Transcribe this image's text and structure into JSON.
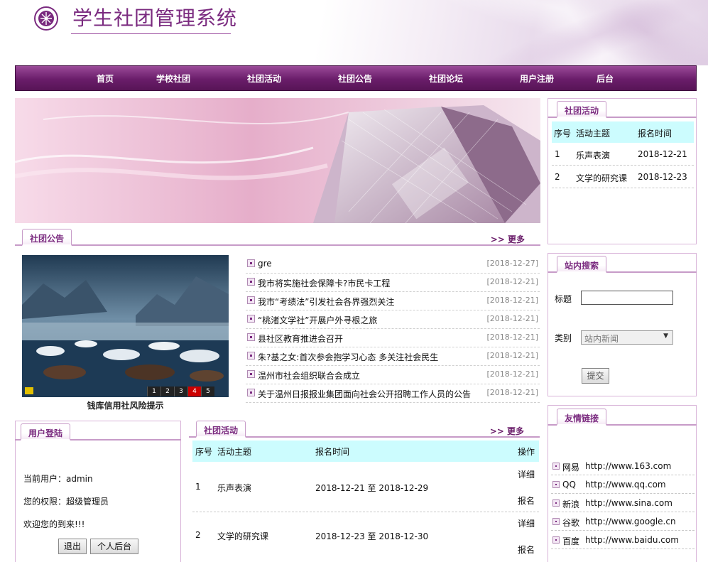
{
  "header": {
    "title": "学生社团管理系统"
  },
  "nav": {
    "items": [
      "首页",
      "学校社团",
      "社团活动",
      "社团公告",
      "社团论坛",
      "用户注册",
      "后台"
    ]
  },
  "notice_panel": {
    "tab_label": "社团公告",
    "more_label": ">> 更多",
    "photo_caption": "钱库信用社风险提示",
    "pager": [
      "1",
      "2",
      "3",
      "4",
      "5"
    ],
    "pager_active": "4",
    "items": [
      {
        "title": "gre",
        "date": "[2018-12-27]"
      },
      {
        "title": "我市将实施社会保障卡?市民卡工程",
        "date": "[2018-12-21]"
      },
      {
        "title": "我市“考绩法”引发社会各界强烈关注",
        "date": "[2018-12-21]"
      },
      {
        "title": "“桃渚文学社”开展户外寻根之旅",
        "date": "[2018-12-21]"
      },
      {
        "title": "县社区教育推进会召开",
        "date": "[2018-12-21]"
      },
      {
        "title": "朱?基之女:首次参会抱学习心态 多关注社会民生",
        "date": "[2018-12-21]"
      },
      {
        "title": "温州市社会组织联合会成立",
        "date": "[2018-12-21]"
      },
      {
        "title": "关于温州日报报业集团面向社会公开招聘工作人员的公告",
        "date": "[2018-12-21]"
      }
    ]
  },
  "sidebar_activity": {
    "tab_label": "社团活动",
    "headers": [
      "序号",
      "活动主题",
      "报名时间"
    ],
    "rows": [
      [
        "1",
        "乐声表演",
        "2018-12-21"
      ],
      [
        "2",
        "文学的研究课",
        "2018-12-23"
      ]
    ]
  },
  "search": {
    "tab_label": "站内搜索",
    "title_label": "标题",
    "title_value": "",
    "category_label": "类别",
    "category_value": "站内新闻",
    "submit_label": "提交"
  },
  "links": {
    "tab_label": "友情链接",
    "items": [
      {
        "name": "网易",
        "url": "http://www.163.com"
      },
      {
        "name": "QQ",
        "url": "http://www.qq.com"
      },
      {
        "name": "新浪",
        "url": "http://www.sina.com"
      },
      {
        "name": "谷歌",
        "url": "http://www.google.cn"
      },
      {
        "name": "百度",
        "url": "http://www.baidu.com"
      }
    ]
  },
  "login": {
    "tab_label": "用户登陆",
    "current_user": "当前用户：admin",
    "permission": "您的权限：超级管理员",
    "welcome": "欢迎您的到来!!!",
    "logout_label": "退出",
    "admin_label": "个人后台"
  },
  "activity_panel": {
    "tab_label": "社团活动",
    "more_label": ">> 更多",
    "headers": [
      "序号",
      "活动主题",
      "报名时间",
      "操作"
    ],
    "rows": [
      {
        "no": "1",
        "topic": "乐声表演",
        "time": "2018-12-21 至 2018-12-29",
        "detail": "详细",
        "signup": "报名"
      },
      {
        "no": "2",
        "topic": "文学的研究课",
        "time": "2018-12-23 至 2018-12-30",
        "detail": "详细",
        "signup": "报名"
      }
    ]
  },
  "colors": {
    "brand": "#7a2a7f",
    "nav_bg": "#6a1d6a",
    "table_header": "#ccfcfe",
    "pager_active": "#cc0000"
  }
}
